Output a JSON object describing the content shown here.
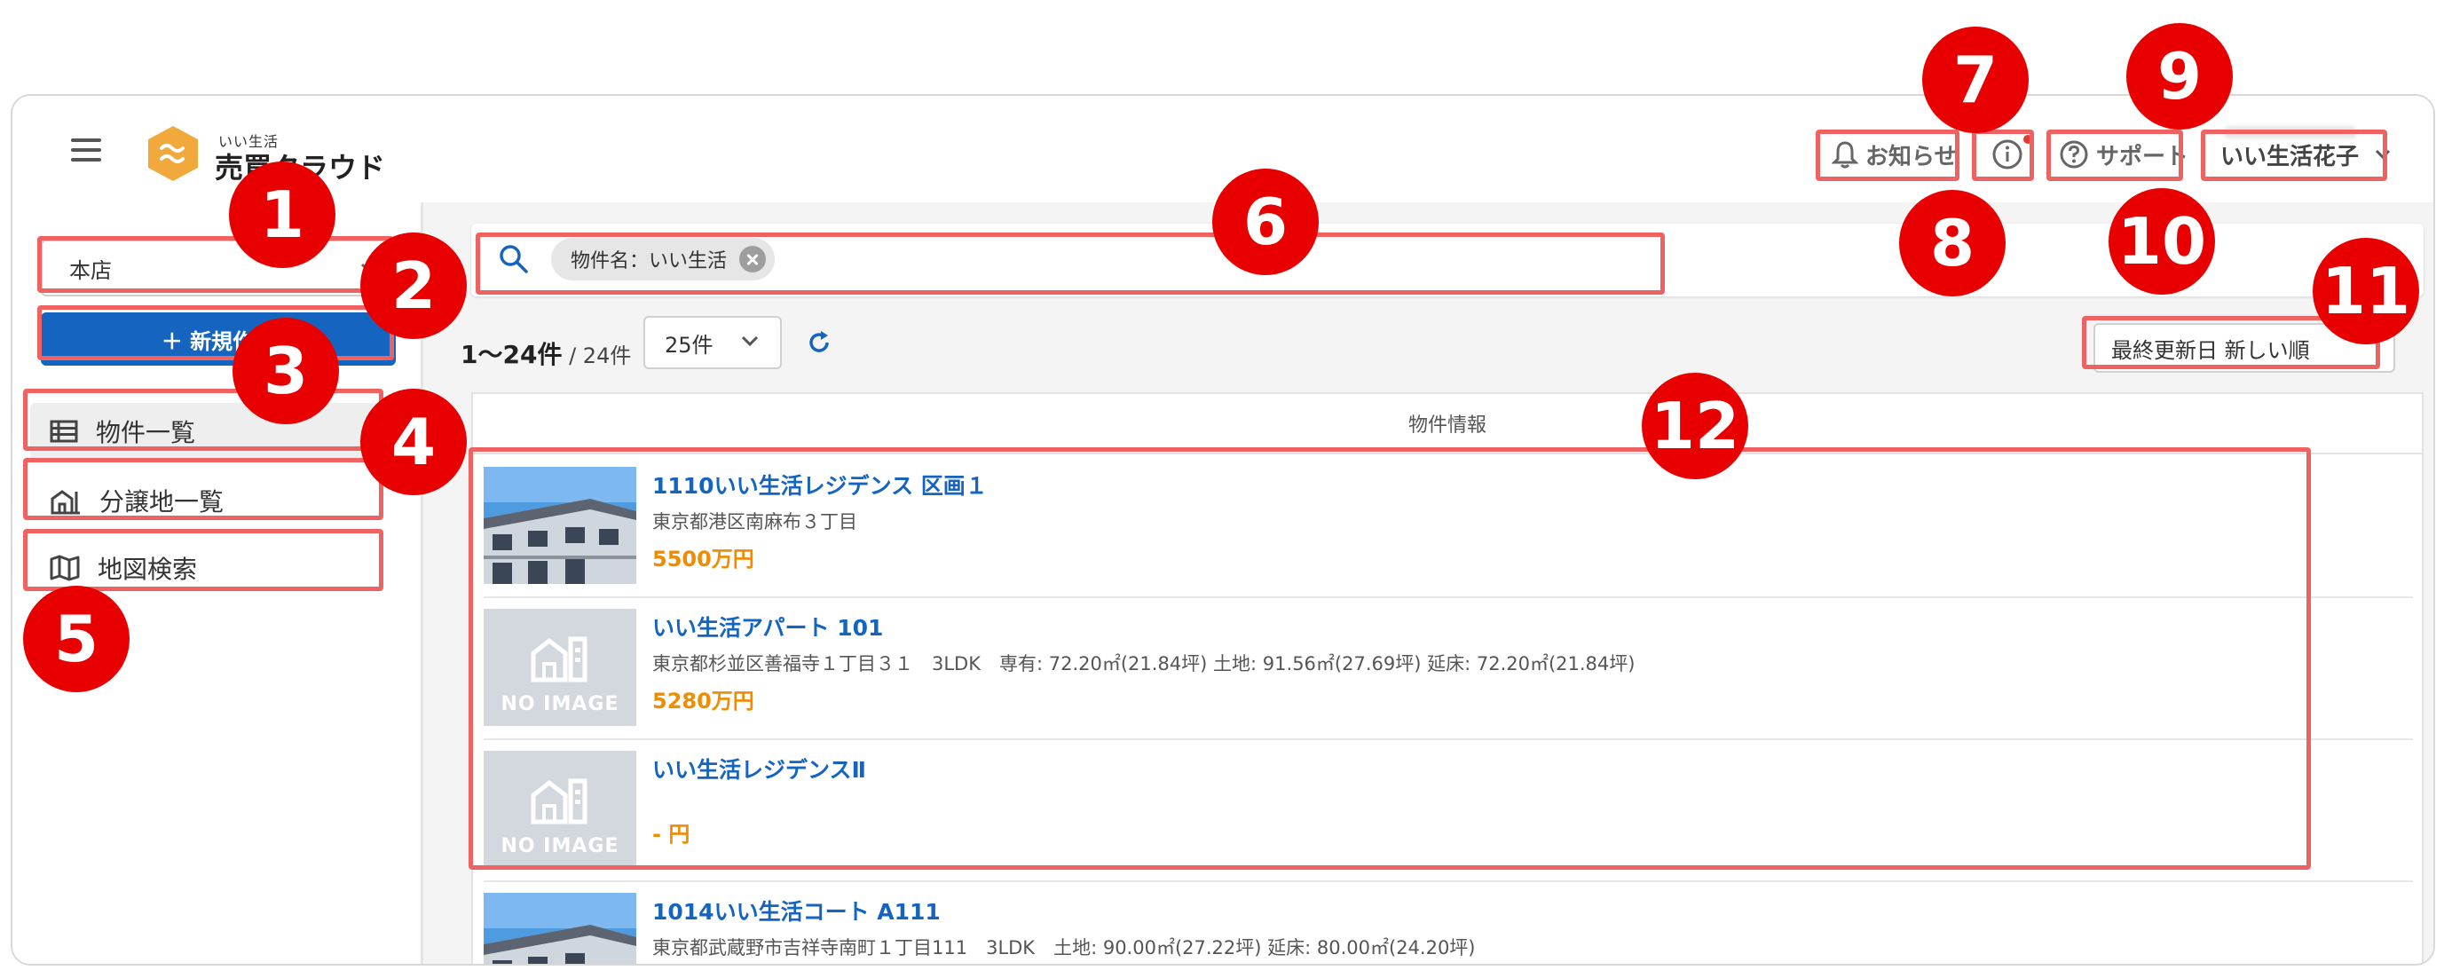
{
  "header": {
    "logo_small": "いい生活",
    "logo_name": "売買クラウド",
    "notice_label": "お知らせ",
    "support_label": "サポート",
    "user_name": "いい生活花子"
  },
  "sidebar": {
    "store": "本店",
    "new_button": "＋ 新規作成",
    "items": [
      {
        "label": "物件一覧",
        "icon": "list-icon"
      },
      {
        "label": "分譲地一覧",
        "icon": "building-icon"
      },
      {
        "label": "地図検索",
        "icon": "map-icon"
      }
    ]
  },
  "search": {
    "chip": "物件名：いい生活"
  },
  "toolbar": {
    "range": "1〜24件",
    "total": " / 24件",
    "per_page": "25件",
    "sort": "最終更新日 新しい順"
  },
  "table": {
    "header": "物件情報",
    "no_image": "NO IMAGE",
    "rows": [
      {
        "title": "1110いい生活レジデンス 区画１",
        "address": "東京都港区南麻布３丁目",
        "price": "5500万円",
        "image": "photo"
      },
      {
        "title": "いい生活アパート 101",
        "address": "東京都杉並区善福寺１丁目３１　3LDK　専有: 72.20㎡(21.84坪) 土地: 91.56㎡(27.69坪) 延床: 72.20㎡(21.84坪)",
        "price": "5280万円",
        "image": "none"
      },
      {
        "title": "いい生活レジデンスⅡ",
        "address": "",
        "price": "- 円",
        "image": "none"
      },
      {
        "title": "1014いい生活コート A111",
        "address": "東京都武蔵野市吉祥寺南町１丁目111　3LDK　土地: 90.00㎡(27.22坪) 延床: 80.00㎡(24.20坪)",
        "price": "",
        "image": "photo"
      }
    ]
  },
  "annotations": [
    "1",
    "2",
    "3",
    "4",
    "5",
    "6",
    "7",
    "8",
    "9",
    "10",
    "11",
    "12"
  ],
  "colors": {
    "accent": "#1565c0",
    "price": "#f08c00",
    "annotation": "#e80000",
    "highlight": "#ef6262"
  }
}
